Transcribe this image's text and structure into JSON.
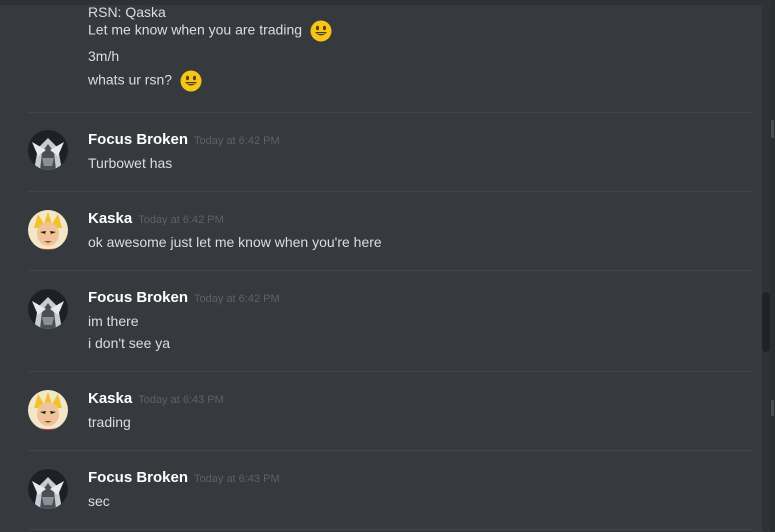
{
  "top_block": {
    "lines": [
      {
        "text": "RSN: Qaska",
        "emoji": false
      },
      {
        "text": "Let me know when you are trading",
        "emoji": true
      },
      {
        "text": "3m/h",
        "emoji": false
      },
      {
        "text": "whats ur rsn?",
        "emoji": true
      }
    ]
  },
  "messages": [
    {
      "author": "Focus Broken",
      "timestamp": "Today at 6:42 PM",
      "avatar": "focus-broken-avatar",
      "lines": [
        "Turbowet has"
      ]
    },
    {
      "author": "Kaska",
      "timestamp": "Today at 6:42 PM",
      "avatar": "kaska-avatar",
      "lines": [
        "ok awesome just let me know when you're here"
      ]
    },
    {
      "author": "Focus Broken",
      "timestamp": "Today at 6:42 PM",
      "avatar": "focus-broken-avatar",
      "lines": [
        "im there",
        "i don't see ya"
      ]
    },
    {
      "author": "Kaska",
      "timestamp": "Today at 6:43 PM",
      "avatar": "kaska-avatar",
      "lines": [
        "trading"
      ]
    },
    {
      "author": "Focus Broken",
      "timestamp": "Today at 6:43 PM",
      "avatar": "focus-broken-avatar",
      "lines": [
        "sec"
      ]
    }
  ],
  "colors": {
    "background": "#36393e",
    "author": "#ffffff",
    "message_text": "#dcddde",
    "timestamp": "#5e6166",
    "divider": "#42454a",
    "emoji": "#f5c518"
  },
  "icons": {
    "emoji": "smiley-emoji-icon"
  }
}
